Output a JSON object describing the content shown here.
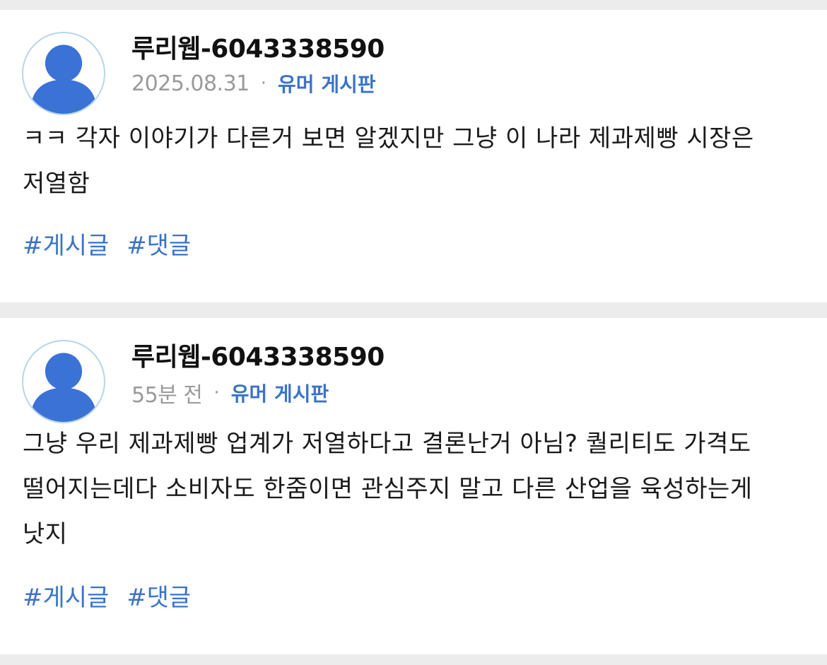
{
  "posts": [
    {
      "author": "루리웹-6043338590",
      "time": "2025.08.31",
      "separator": "·",
      "board": "유머 게시판",
      "avatar_icon": "user-avatar-icon",
      "text": "ㅋㅋ 각자 이야기가 다른거 보면 알겠지만 그냥 이 나라 제과제빵 시장은 저열함",
      "tags": [
        "#게시글",
        "#댓글"
      ]
    },
    {
      "author": "루리웹-6043338590",
      "time": "55분 전",
      "separator": "·",
      "board": "유머 게시판",
      "avatar_icon": "user-avatar-icon",
      "text": "그냥 우리 제과제빵 업계가 저열하다고 결론난거 아님? 퀄리티도 가격도 떨어지는데다 소비자도 한줌이면 관심주지 말고 다른 산업을 육성하는게 낫지",
      "tags": [
        "#게시글",
        "#댓글"
      ]
    }
  ],
  "colors": {
    "background": "#ececec",
    "card": "#ffffff",
    "accent": "#3a73c7",
    "avatar_fill": "#3b72d6",
    "avatar_ring": "#b9d5ea",
    "muted": "#9a9a9a"
  }
}
